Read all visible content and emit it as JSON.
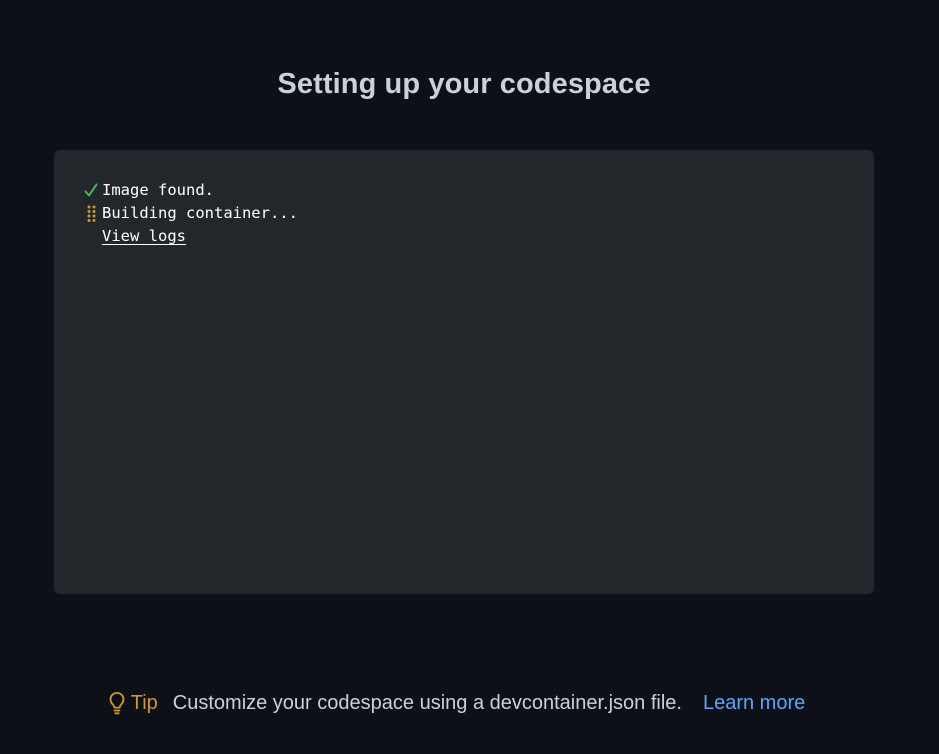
{
  "page": {
    "title": "Setting up your codespace"
  },
  "log": {
    "lines": [
      {
        "status": "done",
        "icon": "check-icon",
        "text": "Image found."
      },
      {
        "status": "in-progress",
        "icon": "spinner-icon",
        "text": "Building container..."
      }
    ],
    "view_logs_label": "View logs"
  },
  "tip": {
    "icon": "lightbulb-icon",
    "label": "Tip",
    "text": "Customize your codespace using a devcontainer.json file.",
    "link_label": "Learn more"
  },
  "colors": {
    "background": "#0d1117",
    "panel": "#23272c",
    "success": "#3fb950",
    "warning": "#d29922",
    "link": "#58a6ff",
    "text": "#c9d1d9"
  }
}
